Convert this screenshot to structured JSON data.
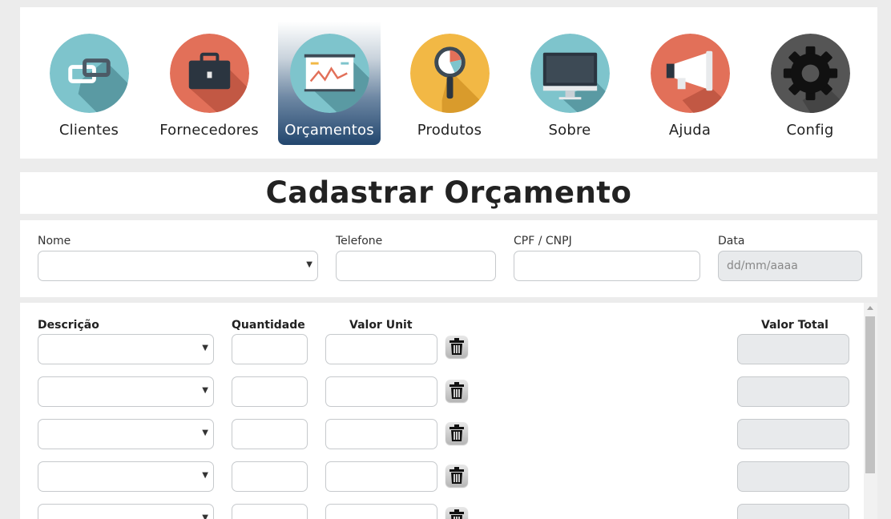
{
  "nav": {
    "items": [
      {
        "label": "Clientes",
        "icon": "clients-link-icon",
        "color": "#7ec4cc"
      },
      {
        "label": "Fornecedores",
        "icon": "briefcase-icon",
        "color": "#e27059"
      },
      {
        "label": "Orçamentos",
        "icon": "presentation-chart-icon",
        "color": "#7ec4cc",
        "active": true
      },
      {
        "label": "Produtos",
        "icon": "magnifier-icon",
        "color": "#f2b845"
      },
      {
        "label": "Sobre",
        "icon": "monitor-icon",
        "color": "#7ec4cc"
      },
      {
        "label": "Ajuda",
        "icon": "megaphone-icon",
        "color": "#e27059"
      },
      {
        "label": "Config",
        "icon": "gear-icon",
        "color": "#555555"
      }
    ]
  },
  "title": "Cadastrar Orçamento",
  "form": {
    "nome_label": "Nome",
    "telefone_label": "Telefone",
    "cpf_label": "CPF / CNPJ",
    "data_label": "Data",
    "data_placeholder": "dd/mm/aaaa"
  },
  "items": {
    "headers": {
      "descricao": "Descrição",
      "quantidade": "Quantidade",
      "valor_unit": "Valor Unit",
      "valor_total": "Valor Total"
    },
    "row_count": 5
  },
  "colors": {
    "background": "#ececec",
    "active_nav": "#22466e",
    "readonly_field": "#e8eaec"
  }
}
